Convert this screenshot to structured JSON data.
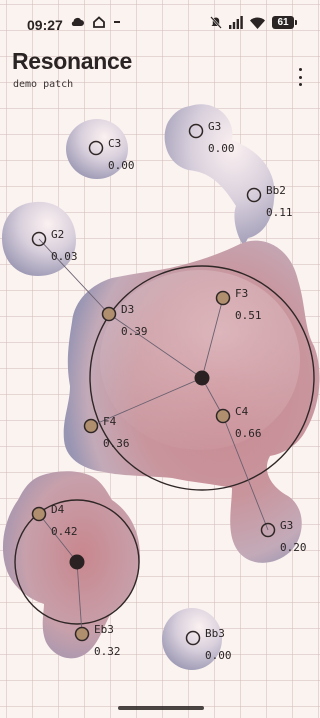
{
  "status_bar": {
    "time": "09:27",
    "battery": "61",
    "left_icons": [
      "cloud-icon",
      "home-outline-icon",
      "dash-icon"
    ],
    "right_icons": [
      "mute-icon",
      "signal-icon",
      "wifi-icon",
      "battery-icon"
    ]
  },
  "header": {
    "title": "Resonance",
    "subtitle": "demo patch",
    "menu_icon": "more-vertical-icon"
  },
  "colors": {
    "background": "#fbf3f0",
    "blob_dark": "#8a8aa8",
    "blob_warm": "#c98e97",
    "ring": "#2f2626",
    "node_fill": "#b08f6e",
    "text": "#2a2424"
  },
  "nodes": [
    {
      "id": "c3-top",
      "note": "C3",
      "value": "0.00",
      "active": false
    },
    {
      "id": "g3-top",
      "note": "G3",
      "value": "0.00",
      "active": false
    },
    {
      "id": "bb2",
      "note": "Bb2",
      "value": "0.11",
      "active": false
    },
    {
      "id": "g2",
      "note": "G2",
      "value": "0.03",
      "active": false
    },
    {
      "id": "d3",
      "note": "D3",
      "value": "0.39",
      "active": true
    },
    {
      "id": "f3",
      "note": "F3",
      "value": "0.51",
      "active": true
    },
    {
      "id": "f4",
      "note": "F4",
      "value": "0.36",
      "active": true
    },
    {
      "id": "c4",
      "note": "C4",
      "value": "0.66",
      "active": true
    },
    {
      "id": "g3-low",
      "note": "G3",
      "value": "0.20",
      "active": false
    },
    {
      "id": "d4",
      "note": "D4",
      "value": "0.42",
      "active": true
    },
    {
      "id": "eb3",
      "note": "Eb3",
      "value": "0.32",
      "active": true
    },
    {
      "id": "bb3",
      "note": "Bb3",
      "value": "0.00",
      "active": false
    }
  ]
}
